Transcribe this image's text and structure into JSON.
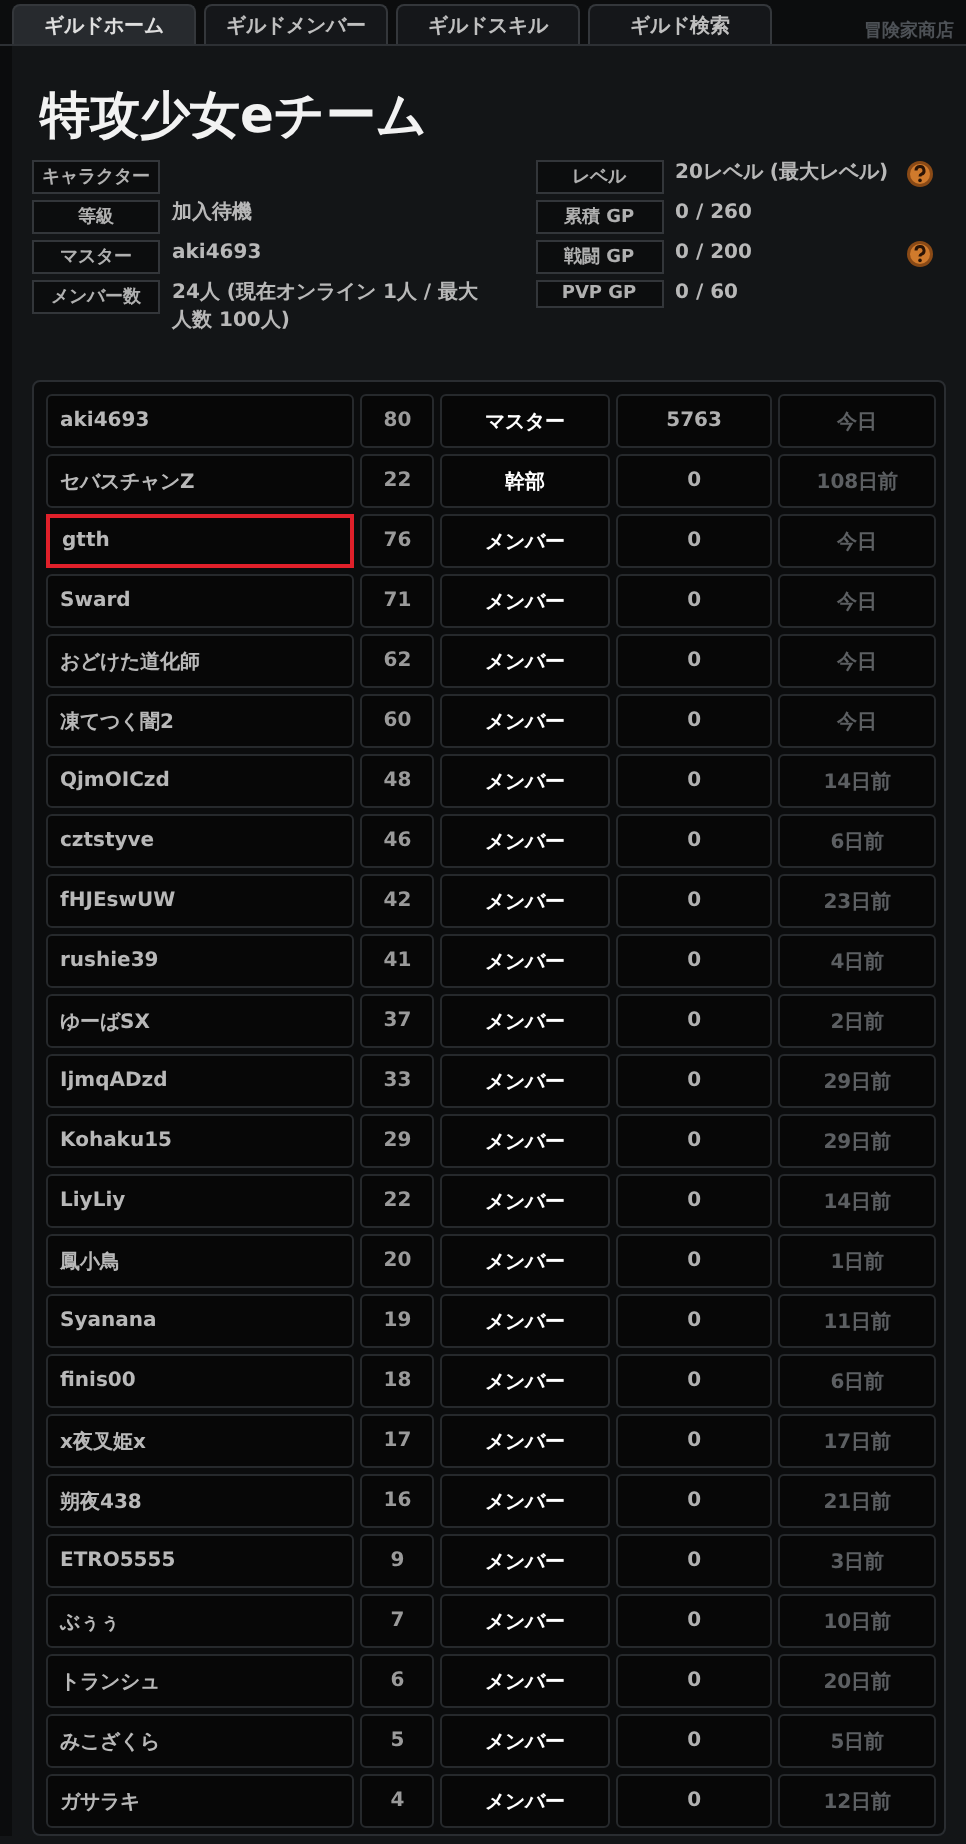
{
  "tabs": [
    {
      "label": "ギルドホーム",
      "selected": true
    },
    {
      "label": "ギルドメンバー",
      "selected": false
    },
    {
      "label": "ギルドスキル",
      "selected": false
    },
    {
      "label": "ギルド検索",
      "selected": false
    }
  ],
  "background_tab": "冒険家商店",
  "guild_name": "特攻少女eチーム",
  "info_left": [
    {
      "label": "キャラクター"
    },
    {
      "label": "等級",
      "value": "加入待機"
    },
    {
      "label": "マスター",
      "value": "aki4693"
    },
    {
      "label": "メンバー数",
      "value": "24人 (現在オンライン 1人 / 最大人数 100人)"
    }
  ],
  "info_right": [
    {
      "label": "レベル",
      "value": "20レベル (最大レベル)",
      "help": true
    },
    {
      "label": "累積 GP",
      "value": "0 / 260",
      "help": false
    },
    {
      "label": "戦闘 GP",
      "value": "0 / 200",
      "help": true
    },
    {
      "label": "PVP GP",
      "value": "0 / 60",
      "help": false
    }
  ],
  "members": [
    {
      "name": "aki4693",
      "level": "80",
      "rank": "マスター",
      "gp": "5763",
      "last_login": "今日",
      "highlighted": false
    },
    {
      "name": "セバスチャンZ",
      "level": "22",
      "rank": "幹部",
      "gp": "0",
      "last_login": "108日前",
      "highlighted": false
    },
    {
      "name": "gtth",
      "level": "76",
      "rank": "メンバー",
      "gp": "0",
      "last_login": "今日",
      "highlighted": true
    },
    {
      "name": "Sward",
      "level": "71",
      "rank": "メンバー",
      "gp": "0",
      "last_login": "今日",
      "highlighted": false
    },
    {
      "name": "おどけた道化師",
      "level": "62",
      "rank": "メンバー",
      "gp": "0",
      "last_login": "今日",
      "highlighted": false
    },
    {
      "name": "凍てつく闇2",
      "level": "60",
      "rank": "メンバー",
      "gp": "0",
      "last_login": "今日",
      "highlighted": false
    },
    {
      "name": "QjmOICzd",
      "level": "48",
      "rank": "メンバー",
      "gp": "0",
      "last_login": "14日前",
      "highlighted": false
    },
    {
      "name": "cztstyve",
      "level": "46",
      "rank": "メンバー",
      "gp": "0",
      "last_login": "6日前",
      "highlighted": false
    },
    {
      "name": "fHJEswUW",
      "level": "42",
      "rank": "メンバー",
      "gp": "0",
      "last_login": "23日前",
      "highlighted": false
    },
    {
      "name": "rushie39",
      "level": "41",
      "rank": "メンバー",
      "gp": "0",
      "last_login": "4日前",
      "highlighted": false
    },
    {
      "name": "ゆーばSX",
      "level": "37",
      "rank": "メンバー",
      "gp": "0",
      "last_login": "2日前",
      "highlighted": false
    },
    {
      "name": "IjmqADzd",
      "level": "33",
      "rank": "メンバー",
      "gp": "0",
      "last_login": "29日前",
      "highlighted": false
    },
    {
      "name": "Kohaku15",
      "level": "29",
      "rank": "メンバー",
      "gp": "0",
      "last_login": "29日前",
      "highlighted": false
    },
    {
      "name": "LiyLiy",
      "level": "22",
      "rank": "メンバー",
      "gp": "0",
      "last_login": "14日前",
      "highlighted": false
    },
    {
      "name": "鳳小鳥",
      "level": "20",
      "rank": "メンバー",
      "gp": "0",
      "last_login": "1日前",
      "highlighted": false
    },
    {
      "name": "Syanana",
      "level": "19",
      "rank": "メンバー",
      "gp": "0",
      "last_login": "11日前",
      "highlighted": false
    },
    {
      "name": "finis00",
      "level": "18",
      "rank": "メンバー",
      "gp": "0",
      "last_login": "6日前",
      "highlighted": false
    },
    {
      "name": "x夜叉姫x",
      "level": "17",
      "rank": "メンバー",
      "gp": "0",
      "last_login": "17日前",
      "highlighted": false
    },
    {
      "name": "朔夜438",
      "level": "16",
      "rank": "メンバー",
      "gp": "0",
      "last_login": "21日前",
      "highlighted": false
    },
    {
      "name": "ETRO5555",
      "level": "9",
      "rank": "メンバー",
      "gp": "0",
      "last_login": "3日前",
      "highlighted": false
    },
    {
      "name": "ぶぅぅ",
      "level": "7",
      "rank": "メンバー",
      "gp": "0",
      "last_login": "10日前",
      "highlighted": false
    },
    {
      "name": "トランシュ",
      "level": "6",
      "rank": "メンバー",
      "gp": "0",
      "last_login": "20日前",
      "highlighted": false
    },
    {
      "name": "みこざくら",
      "level": "5",
      "rank": "メンバー",
      "gp": "0",
      "last_login": "5日前",
      "highlighted": false
    },
    {
      "name": "ガサラキ",
      "level": "4",
      "rank": "メンバー",
      "gp": "0",
      "last_login": "12日前",
      "highlighted": false
    }
  ]
}
